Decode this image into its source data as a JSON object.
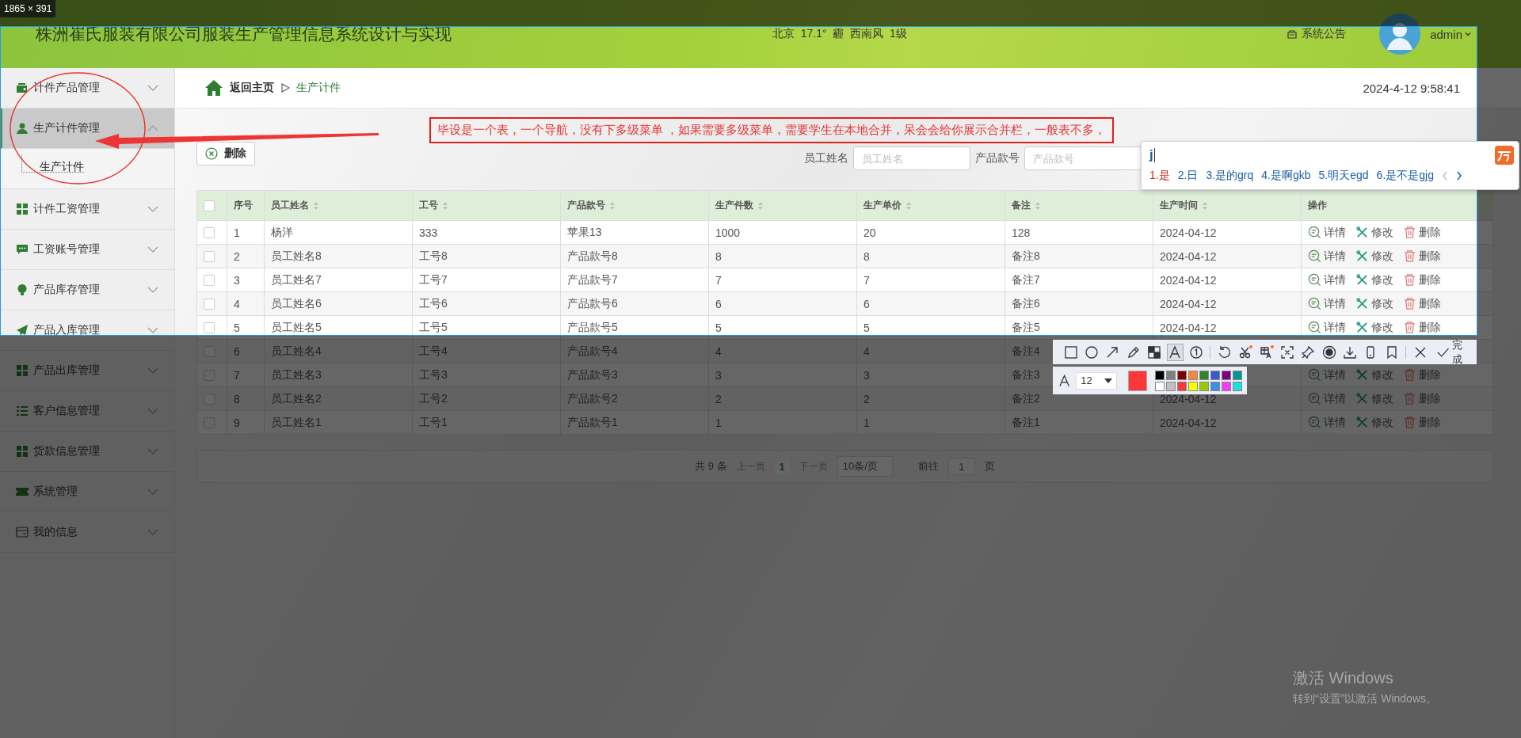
{
  "size_label": "1865 × 391",
  "header": {
    "title": "株洲崔氏服装有限公司服装生产管理信息系统设计与实现",
    "weather": "北京  17.1°  霾  西南风  1级",
    "notice": "系统公告",
    "user": "admin"
  },
  "sidebar": {
    "items": [
      {
        "label": "计件产品管理",
        "kind": "wallet",
        "selected": false,
        "expanded": false
      },
      {
        "label": "生产计件管理",
        "kind": "person",
        "selected": true,
        "expanded": true,
        "children": [
          {
            "label": "生产计件"
          }
        ]
      },
      {
        "label": "计件工资管理",
        "kind": "grid",
        "selected": false,
        "expanded": false
      },
      {
        "label": "工资账号管理",
        "kind": "chat",
        "selected": false,
        "expanded": false
      },
      {
        "label": "产品库存管理",
        "kind": "bulb",
        "selected": false,
        "expanded": false
      },
      {
        "label": "产品入库管理",
        "kind": "plane",
        "selected": false,
        "expanded": false
      },
      {
        "label": "产品出库管理",
        "kind": "grid",
        "selected": false,
        "expanded": false
      },
      {
        "label": "客户信息管理",
        "kind": "list",
        "selected": false,
        "expanded": false
      },
      {
        "label": "货款信息管理",
        "kind": "grid",
        "selected": false,
        "expanded": false
      },
      {
        "label": "系统管理",
        "kind": "ticket",
        "selected": false,
        "expanded": false
      },
      {
        "label": "我的信息",
        "kind": "card",
        "selected": false,
        "expanded": false
      }
    ]
  },
  "breadcrumb": {
    "home": "返回主页",
    "current": "生产计件"
  },
  "datetime": "2024-4-12 9:58:41",
  "toolbar": {
    "delete_button": "删除",
    "filters": [
      {
        "label": "员工姓名",
        "placeholder": "员工姓名"
      },
      {
        "label": "产品款号",
        "placeholder": "产品款号"
      }
    ]
  },
  "table": {
    "select_all_checked": false,
    "columns": [
      {
        "label": "序号",
        "sortable": false
      },
      {
        "label": "员工姓名",
        "sortable": true
      },
      {
        "label": "工号",
        "sortable": true
      },
      {
        "label": "产品款号",
        "sortable": true
      },
      {
        "label": "生产件数",
        "sortable": true
      },
      {
        "label": "生产单价",
        "sortable": true
      },
      {
        "label": "备注",
        "sortable": true
      },
      {
        "label": "生产时间",
        "sortable": true
      },
      {
        "label": "操作",
        "sortable": false
      }
    ],
    "rows": [
      {
        "checked": false,
        "cells": [
          "1",
          "杨洋",
          "333",
          "苹果13",
          "1000",
          "20",
          "128",
          "2024-04-12"
        ],
        "actions": [
          "详情",
          "修改",
          "删除"
        ]
      },
      {
        "checked": false,
        "cells": [
          "2",
          "员工姓名8",
          "工号8",
          "产品款号8",
          "8",
          "8",
          "备注8",
          "2024-04-12"
        ],
        "actions": [
          "详情",
          "修改",
          "删除"
        ]
      },
      {
        "checked": false,
        "cells": [
          "3",
          "员工姓名7",
          "工号7",
          "产品款号7",
          "7",
          "7",
          "备注7",
          "2024-04-12"
        ],
        "actions": [
          "详情",
          "修改",
          "删除"
        ]
      },
      {
        "checked": false,
        "cells": [
          "4",
          "员工姓名6",
          "工号6",
          "产品款号6",
          "6",
          "6",
          "备注6",
          "2024-04-12"
        ],
        "actions": [
          "详情",
          "修改",
          "删除"
        ]
      },
      {
        "checked": false,
        "cells": [
          "5",
          "员工姓名5",
          "工号5",
          "产品款号5",
          "5",
          "5",
          "备注5",
          "2024-04-12"
        ],
        "actions": [
          "详情",
          "修改",
          "删除"
        ]
      },
      {
        "checked": false,
        "cells": [
          "6",
          "员工姓名4",
          "工号4",
          "产品款号4",
          "4",
          "4",
          "备注4"
        ]
      },
      {
        "checked": false,
        "cells": [
          "7",
          "员工姓名3",
          "工号3",
          "产品款号3",
          "3",
          "3",
          "备注3"
        ],
        "actions": [
          "详情",
          "修改",
          "删除"
        ]
      },
      {
        "checked": false,
        "cells": [
          "8",
          "员工姓名2",
          "工号2",
          "产品款号2",
          "2",
          "2",
          "备注2",
          "2024-04-12"
        ],
        "actions": [
          "详情",
          "修改",
          "删除"
        ]
      },
      {
        "checked": false,
        "cells": [
          "9",
          "员工姓名1",
          "工号1",
          "产品款号1",
          "1",
          "1",
          "备注1",
          "2024-04-12"
        ],
        "actions": [
          "详情",
          "修改",
          "删除"
        ]
      }
    ]
  },
  "pagination": {
    "total": "共 9 条",
    "prev": {
      "label": "上一页",
      "disabled": true
    },
    "pages": [
      {
        "label": "1",
        "selected": true
      }
    ],
    "next": {
      "label": "下一页",
      "disabled": true
    },
    "page_size": "10条/页",
    "goto_label": "前往",
    "goto_value": "1",
    "goto_suffix": "页"
  },
  "annotation": {
    "text": "毕设是一个表，一个导航，没有下多级菜单 ，如果需要多级菜单，需要学生在本地合并，呆会会给你展示合并栏，一般表不多，"
  },
  "ime": {
    "input": "j",
    "candidates": [
      {
        "label": "1.是",
        "selected": true
      },
      {
        "label": "2.日",
        "selected": false
      },
      {
        "label": "3.是的grq",
        "selected": false
      },
      {
        "label": "4.是啊gkb",
        "selected": false
      },
      {
        "label": "5.明天egd",
        "selected": false
      },
      {
        "label": "6.是不是gjg",
        "selected": false
      }
    ]
  },
  "capture_toolbar": {
    "tool_groups": [
      [
        {
          "kind": "rectangle",
          "selected": false,
          "badge": false
        },
        {
          "kind": "ellipse",
          "selected": false,
          "badge": false
        },
        {
          "kind": "arrow",
          "selected": false,
          "badge": false
        },
        {
          "kind": "pencil",
          "selected": false,
          "badge": false
        },
        {
          "kind": "mosaic",
          "selected": false,
          "badge": false
        },
        {
          "kind": "text",
          "selected": true,
          "badge": false
        },
        {
          "kind": "number",
          "selected": false,
          "badge": false
        }
      ],
      [
        {
          "kind": "undo",
          "selected": false,
          "badge": false
        },
        {
          "kind": "scissors",
          "selected": false,
          "badge": true
        },
        {
          "kind": "ocr",
          "selected": false,
          "badge": true
        },
        {
          "kind": "crop",
          "selected": false,
          "badge": false
        },
        {
          "kind": "pin",
          "selected": false,
          "badge": false
        },
        {
          "kind": "record",
          "selected": false,
          "badge": false
        },
        {
          "kind": "download",
          "selected": false,
          "badge": false
        },
        {
          "kind": "phone",
          "selected": false,
          "badge": false
        },
        {
          "kind": "bookmark",
          "selected": false,
          "badge": false
        }
      ],
      [
        {
          "kind": "close",
          "selected": false,
          "badge": false
        }
      ]
    ],
    "done_label": "完成",
    "font_size": "12",
    "current_colors": [
      {
        "color": "#fb3838"
      }
    ],
    "palette": [
      {
        "color": "#000000"
      },
      {
        "color": "#808080"
      },
      {
        "color": "#800000"
      },
      {
        "color": "#f7883a"
      },
      {
        "color": "#308430"
      },
      {
        "color": "#385ad3"
      },
      {
        "color": "#800080"
      },
      {
        "color": "#009999"
      },
      {
        "color": "#ffffff"
      },
      {
        "color": "#c0c0c0"
      },
      {
        "color": "#fb3838"
      },
      {
        "color": "#ffff00"
      },
      {
        "color": "#99cc00"
      },
      {
        "color": "#3d8ee6"
      },
      {
        "color": "#fb3bfb"
      },
      {
        "color": "#1de0e0"
      }
    ]
  },
  "os_notice": {
    "title": "激活 Windows",
    "subtitle": "转到“设置”以激活 Windows。"
  }
}
